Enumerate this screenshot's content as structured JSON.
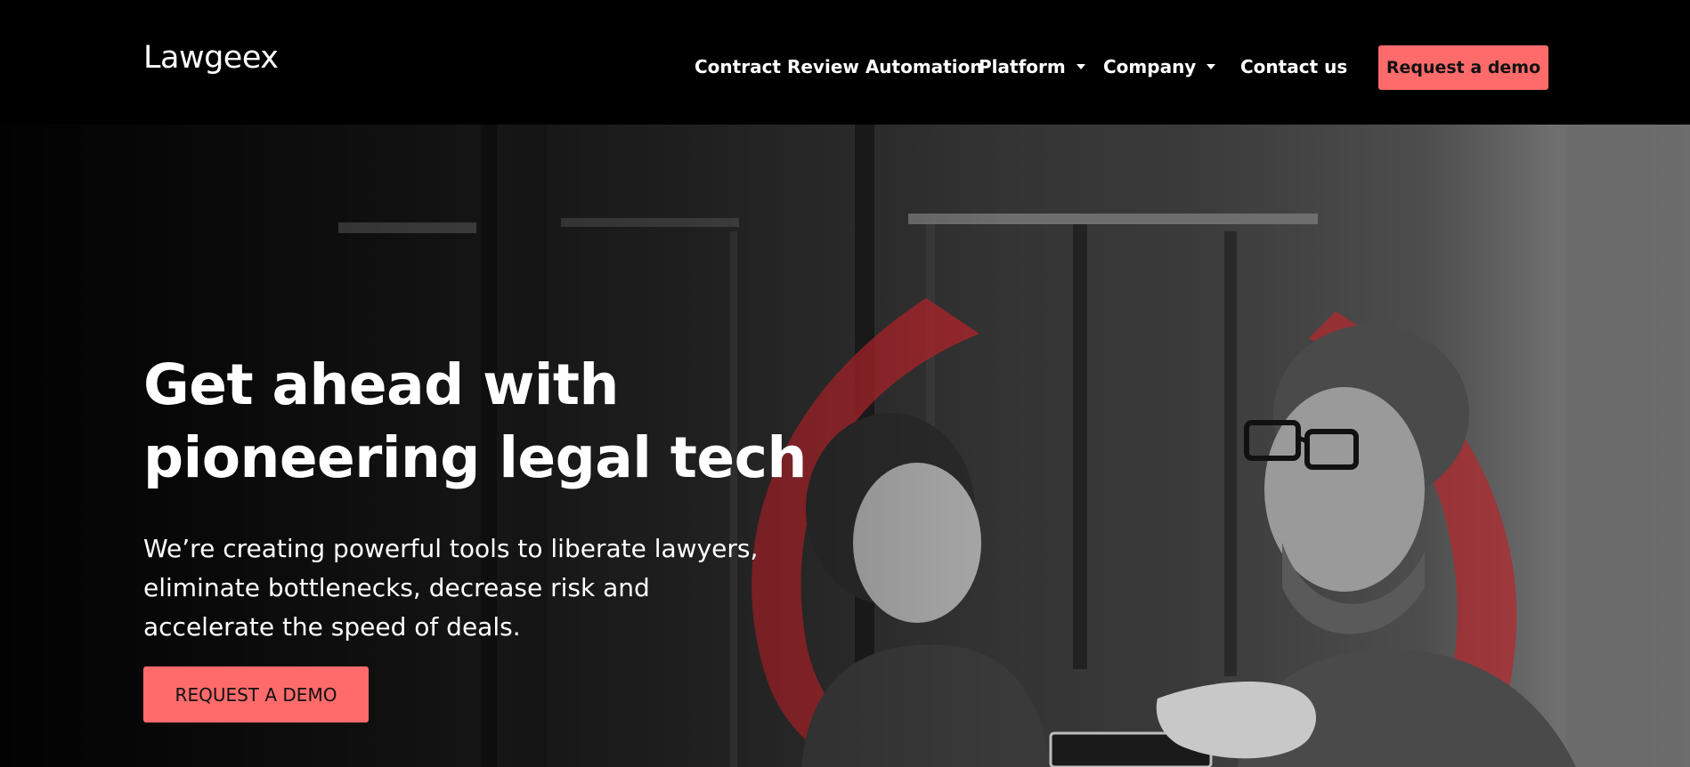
{
  "brand": {
    "logo_text": "Lawgeex",
    "accent_color": "#ff6b6b"
  },
  "nav": {
    "items": [
      {
        "label": "Contract Review Automation",
        "has_dropdown": false
      },
      {
        "label": "Platform",
        "has_dropdown": true,
        "icon": "caret-down-icon"
      },
      {
        "label": "Company",
        "has_dropdown": true,
        "icon": "caret-down-icon"
      },
      {
        "label": "Contact us",
        "has_dropdown": false
      }
    ],
    "cta_label": "Request a demo"
  },
  "hero": {
    "title_line1": "Get ahead with",
    "title_line2": "pioneering legal tech",
    "subtitle_line1": "We’re creating powerful tools to liberate lawyers,",
    "subtitle_line2": "eliminate bottlenecks, decrease risk and",
    "subtitle_line3": "accelerate the speed of deals.",
    "cta_label": "REQUEST A DEMO"
  }
}
